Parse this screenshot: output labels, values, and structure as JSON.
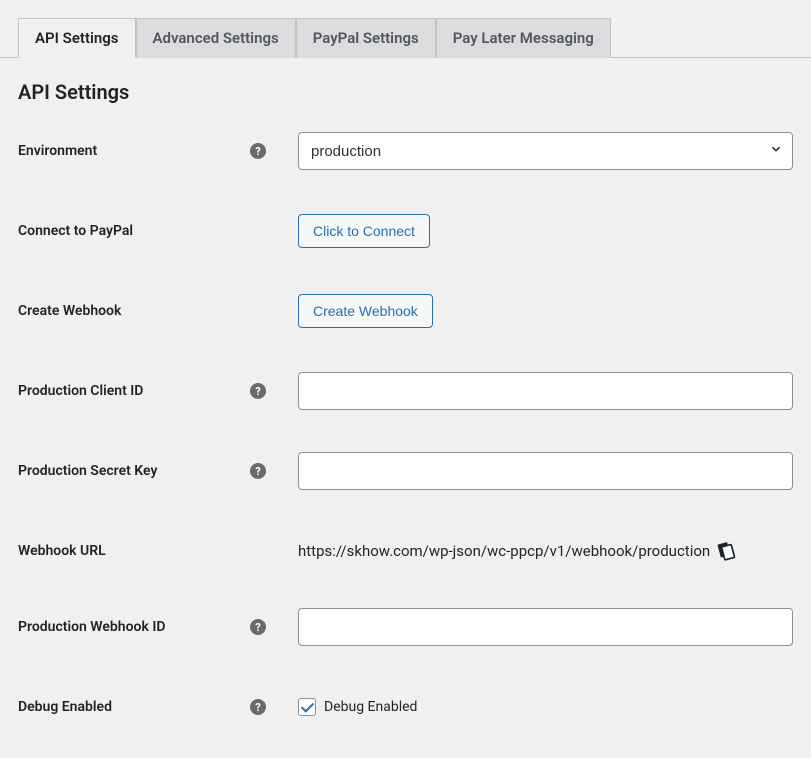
{
  "tabs": {
    "items": [
      {
        "label": "API Settings",
        "active": true
      },
      {
        "label": "Advanced Settings",
        "active": false
      },
      {
        "label": "PayPal Settings",
        "active": false
      },
      {
        "label": "Pay Later Messaging",
        "active": false
      }
    ]
  },
  "heading": "API Settings",
  "fields": {
    "environment": {
      "label": "Environment",
      "value": "production"
    },
    "connect": {
      "label": "Connect to PayPal",
      "button": "Click to Connect"
    },
    "create_webhook": {
      "label": "Create Webhook",
      "button": "Create Webhook"
    },
    "client_id": {
      "label": "Production Client ID",
      "value": ""
    },
    "secret_key": {
      "label": "Production Secret Key",
      "value": ""
    },
    "webhook_url": {
      "label": "Webhook URL",
      "value": "https://skhow.com/wp-json/wc-ppcp/v1/webhook/production"
    },
    "webhook_id": {
      "label": "Production Webhook ID",
      "value": ""
    },
    "debug": {
      "label": "Debug Enabled",
      "checkbox_label": "Debug Enabled",
      "checked": true
    }
  }
}
